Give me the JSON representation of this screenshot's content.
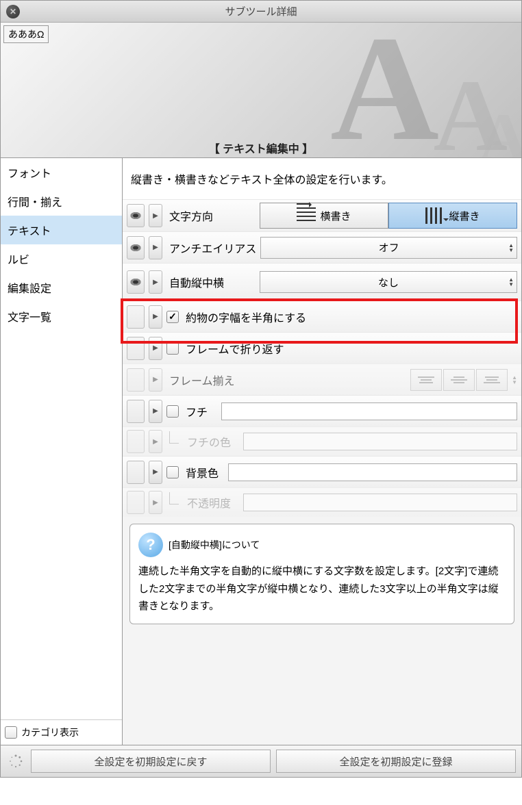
{
  "window": {
    "title": "サブツール詳細"
  },
  "preview": {
    "sample": "あああΩ",
    "banner": "【 テキスト編集中 】"
  },
  "sidebar": {
    "items": [
      {
        "label": "フォント"
      },
      {
        "label": "行間・揃え"
      },
      {
        "label": "テキスト",
        "active": true
      },
      {
        "label": "ルビ"
      },
      {
        "label": "編集設定"
      },
      {
        "label": "文字一覧"
      }
    ],
    "category_show": "カテゴリ表示"
  },
  "main": {
    "desc": "縦書き・横書きなどテキスト全体の設定を行います。",
    "rows": {
      "direction": {
        "label": "文字方向",
        "horizontal": "横書き",
        "vertical": "縦書き"
      },
      "antialias": {
        "label": "アンチエイリアス",
        "value": "オフ"
      },
      "auto_tcy": {
        "label": "自動縦中横",
        "value": "なし"
      },
      "half_punct": {
        "label": "約物の字幅を半角にする"
      },
      "frame_wrap": {
        "label": "フレームで折り返す"
      },
      "frame_align": {
        "label": "フレーム揃え"
      },
      "edge": {
        "label": "フチ"
      },
      "edge_color": {
        "label": "フチの色"
      },
      "bg_color": {
        "label": "背景色"
      },
      "opacity": {
        "label": "不透明度"
      }
    },
    "help": {
      "title": "[自動縦中横]について",
      "body": "連続した半角文字を自動的に縦中横にする文字数を設定します。[2文字]で連続した2文字までの半角文字が縦中横となり、連続した3文字以上の半角文字は縦書きとなります。"
    }
  },
  "footer": {
    "reset": "全設定を初期設定に戻す",
    "register": "全設定を初期設定に登録"
  }
}
